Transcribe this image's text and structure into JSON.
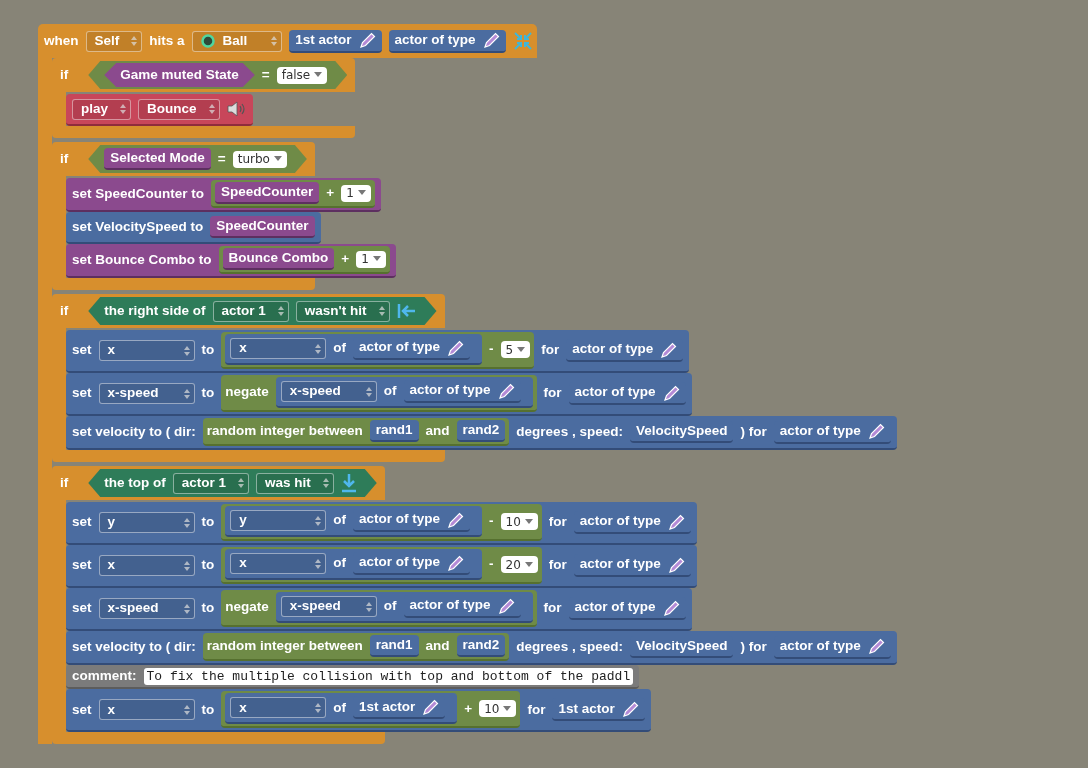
{
  "event": {
    "parts": [
      {
        "kind": "label",
        "text": "when"
      },
      {
        "kind": "select",
        "text": "Self"
      },
      {
        "kind": "label",
        "text": "hits a"
      },
      {
        "kind": "actor_type_select",
        "text": "Ball"
      },
      {
        "kind": "actor",
        "text": "1st actor"
      },
      {
        "kind": "actor",
        "text": "actor of type"
      },
      {
        "kind": "collapse"
      }
    ],
    "body": [
      {
        "label": "if",
        "condition": {
          "kind": "compare",
          "parts": [
            {
              "kind": "bool_attribute",
              "text": "Game muted State"
            },
            {
              "kind": "label",
              "text": "="
            },
            {
              "kind": "number",
              "text": "false"
            }
          ]
        },
        "body": [
          {
            "kind": "sound",
            "parts": [
              {
                "kind": "select",
                "text": "play"
              },
              {
                "kind": "select",
                "text": "Bounce"
              },
              {
                "kind": "speaker"
              }
            ]
          }
        ]
      },
      {
        "label": "if",
        "condition": {
          "kind": "compare",
          "parts": [
            {
              "kind": "attribute",
              "text": "Selected Mode"
            },
            {
              "kind": "label",
              "text": "="
            },
            {
              "kind": "number",
              "text": "turbo"
            }
          ]
        },
        "body": [
          {
            "kind": "attribute",
            "parts": [
              {
                "kind": "label",
                "text": "set SpeedCounter to"
              },
              {
                "kind": "math",
                "parts": [
                  {
                    "kind": "attribute",
                    "text": "SpeedCounter"
                  },
                  {
                    "kind": "label",
                    "text": "+"
                  },
                  {
                    "kind": "number",
                    "text": "1"
                  }
                ]
              }
            ]
          },
          {
            "kind": "game",
            "parts": [
              {
                "kind": "label",
                "text": "set VelocitySpeed to"
              },
              {
                "kind": "attribute",
                "text": "SpeedCounter"
              }
            ]
          },
          {
            "kind": "attribute",
            "parts": [
              {
                "kind": "label",
                "text": "set Bounce Combo to"
              },
              {
                "kind": "math",
                "parts": [
                  {
                    "kind": "attribute",
                    "text": "Bounce Combo"
                  },
                  {
                    "kind": "label",
                    "text": "+"
                  },
                  {
                    "kind": "number",
                    "text": "1"
                  }
                ]
              }
            ]
          }
        ]
      },
      {
        "label": "if",
        "condition": {
          "kind": "collision",
          "parts": [
            {
              "kind": "label",
              "text": "the right side of"
            },
            {
              "kind": "select",
              "text": "actor 1"
            },
            {
              "kind": "select",
              "text": "wasn't hit"
            },
            {
              "kind": "arrow_left"
            }
          ]
        },
        "body": [
          {
            "kind": "actor",
            "parts": [
              {
                "kind": "label",
                "text": "set"
              },
              {
                "kind": "select",
                "text": "x"
              },
              {
                "kind": "label",
                "text": "to"
              },
              {
                "kind": "math",
                "parts": [
                  {
                    "kind": "getter",
                    "parts": [
                      {
                        "kind": "select",
                        "text": "x"
                      },
                      {
                        "kind": "label",
                        "text": "of"
                      },
                      {
                        "kind": "actor",
                        "text": "actor of type"
                      }
                    ]
                  },
                  {
                    "kind": "label",
                    "text": "-"
                  },
                  {
                    "kind": "number",
                    "text": "5"
                  }
                ]
              },
              {
                "kind": "label",
                "text": "for"
              },
              {
                "kind": "actor",
                "text": "actor of type"
              }
            ]
          },
          {
            "kind": "actor",
            "parts": [
              {
                "kind": "label",
                "text": "set"
              },
              {
                "kind": "select",
                "text": "x-speed"
              },
              {
                "kind": "label",
                "text": "to"
              },
              {
                "kind": "math",
                "parts": [
                  {
                    "kind": "label",
                    "text": "negate"
                  },
                  {
                    "kind": "getter",
                    "parts": [
                      {
                        "kind": "select",
                        "text": "x-speed"
                      },
                      {
                        "kind": "label",
                        "text": "of"
                      },
                      {
                        "kind": "actor",
                        "text": "actor of type"
                      }
                    ]
                  }
                ]
              },
              {
                "kind": "label",
                "text": "for"
              },
              {
                "kind": "actor",
                "text": "actor of type"
              }
            ]
          },
          {
            "kind": "actor",
            "parts": [
              {
                "kind": "label",
                "text": "set velocity to ( dir:"
              },
              {
                "kind": "math",
                "parts": [
                  {
                    "kind": "label",
                    "text": "random integer between"
                  },
                  {
                    "kind": "variable",
                    "text": "rand1"
                  },
                  {
                    "kind": "label",
                    "text": "and"
                  },
                  {
                    "kind": "variable",
                    "text": "rand2"
                  }
                ]
              },
              {
                "kind": "label",
                "text": "degrees , speed:"
              },
              {
                "kind": "variable",
                "text": "VelocitySpeed"
              },
              {
                "kind": "label",
                "text": ") for"
              },
              {
                "kind": "actor",
                "text": "actor of type"
              }
            ]
          }
        ]
      },
      {
        "label": "if",
        "condition": {
          "kind": "collision",
          "parts": [
            {
              "kind": "label",
              "text": "the top of"
            },
            {
              "kind": "select",
              "text": "actor 1"
            },
            {
              "kind": "select",
              "text": "was hit"
            },
            {
              "kind": "arrow_down"
            }
          ]
        },
        "body": [
          {
            "kind": "actor",
            "parts": [
              {
                "kind": "label",
                "text": "set"
              },
              {
                "kind": "select",
                "text": "y"
              },
              {
                "kind": "label",
                "text": "to"
              },
              {
                "kind": "math",
                "parts": [
                  {
                    "kind": "getter",
                    "parts": [
                      {
                        "kind": "select",
                        "text": "y"
                      },
                      {
                        "kind": "label",
                        "text": "of"
                      },
                      {
                        "kind": "actor",
                        "text": "actor of type"
                      }
                    ]
                  },
                  {
                    "kind": "label",
                    "text": "-"
                  },
                  {
                    "kind": "number",
                    "text": "10"
                  }
                ]
              },
              {
                "kind": "label",
                "text": "for"
              },
              {
                "kind": "actor",
                "text": "actor of type"
              }
            ]
          },
          {
            "kind": "actor",
            "parts": [
              {
                "kind": "label",
                "text": "set"
              },
              {
                "kind": "select",
                "text": "x"
              },
              {
                "kind": "label",
                "text": "to"
              },
              {
                "kind": "math",
                "parts": [
                  {
                    "kind": "getter",
                    "parts": [
                      {
                        "kind": "select",
                        "text": "x"
                      },
                      {
                        "kind": "label",
                        "text": "of"
                      },
                      {
                        "kind": "actor",
                        "text": "actor of type"
                      }
                    ]
                  },
                  {
                    "kind": "label",
                    "text": "-"
                  },
                  {
                    "kind": "number",
                    "text": "20"
                  }
                ]
              },
              {
                "kind": "label",
                "text": "for"
              },
              {
                "kind": "actor",
                "text": "actor of type"
              }
            ]
          },
          {
            "kind": "actor",
            "parts": [
              {
                "kind": "label",
                "text": "set"
              },
              {
                "kind": "select",
                "text": "x-speed"
              },
              {
                "kind": "label",
                "text": "to"
              },
              {
                "kind": "math",
                "parts": [
                  {
                    "kind": "label",
                    "text": "negate"
                  },
                  {
                    "kind": "getter",
                    "parts": [
                      {
                        "kind": "select",
                        "text": "x-speed"
                      },
                      {
                        "kind": "label",
                        "text": "of"
                      },
                      {
                        "kind": "actor",
                        "text": "actor of type"
                      }
                    ]
                  }
                ]
              },
              {
                "kind": "label",
                "text": "for"
              },
              {
                "kind": "actor",
                "text": "actor of type"
              }
            ]
          },
          {
            "kind": "actor",
            "parts": [
              {
                "kind": "label",
                "text": "set velocity to ( dir:"
              },
              {
                "kind": "math",
                "parts": [
                  {
                    "kind": "label",
                    "text": "random integer between"
                  },
                  {
                    "kind": "variable",
                    "text": "rand1"
                  },
                  {
                    "kind": "label",
                    "text": "and"
                  },
                  {
                    "kind": "variable",
                    "text": "rand2"
                  }
                ]
              },
              {
                "kind": "label",
                "text": "degrees , speed:"
              },
              {
                "kind": "variable",
                "text": "VelocitySpeed"
              },
              {
                "kind": "label",
                "text": ") for"
              },
              {
                "kind": "actor",
                "text": "actor of type"
              }
            ]
          },
          {
            "kind": "comment",
            "parts": [
              {
                "kind": "label",
                "text": "comment:"
              },
              {
                "kind": "comment_field",
                "text": "To fix the multiple collision with top and bottom of the paddl"
              }
            ]
          },
          {
            "kind": "actor",
            "parts": [
              {
                "kind": "label",
                "text": "set"
              },
              {
                "kind": "select",
                "text": "x"
              },
              {
                "kind": "label",
                "text": "to"
              },
              {
                "kind": "math",
                "parts": [
                  {
                    "kind": "getter",
                    "parts": [
                      {
                        "kind": "select",
                        "text": "x"
                      },
                      {
                        "kind": "label",
                        "text": "of"
                      },
                      {
                        "kind": "actor",
                        "text": "1st actor"
                      }
                    ]
                  },
                  {
                    "kind": "label",
                    "text": "+"
                  },
                  {
                    "kind": "number",
                    "text": "10"
                  }
                ]
              },
              {
                "kind": "label",
                "text": "for"
              },
              {
                "kind": "actor",
                "text": "1st actor"
              }
            ]
          }
        ]
      }
    ]
  }
}
